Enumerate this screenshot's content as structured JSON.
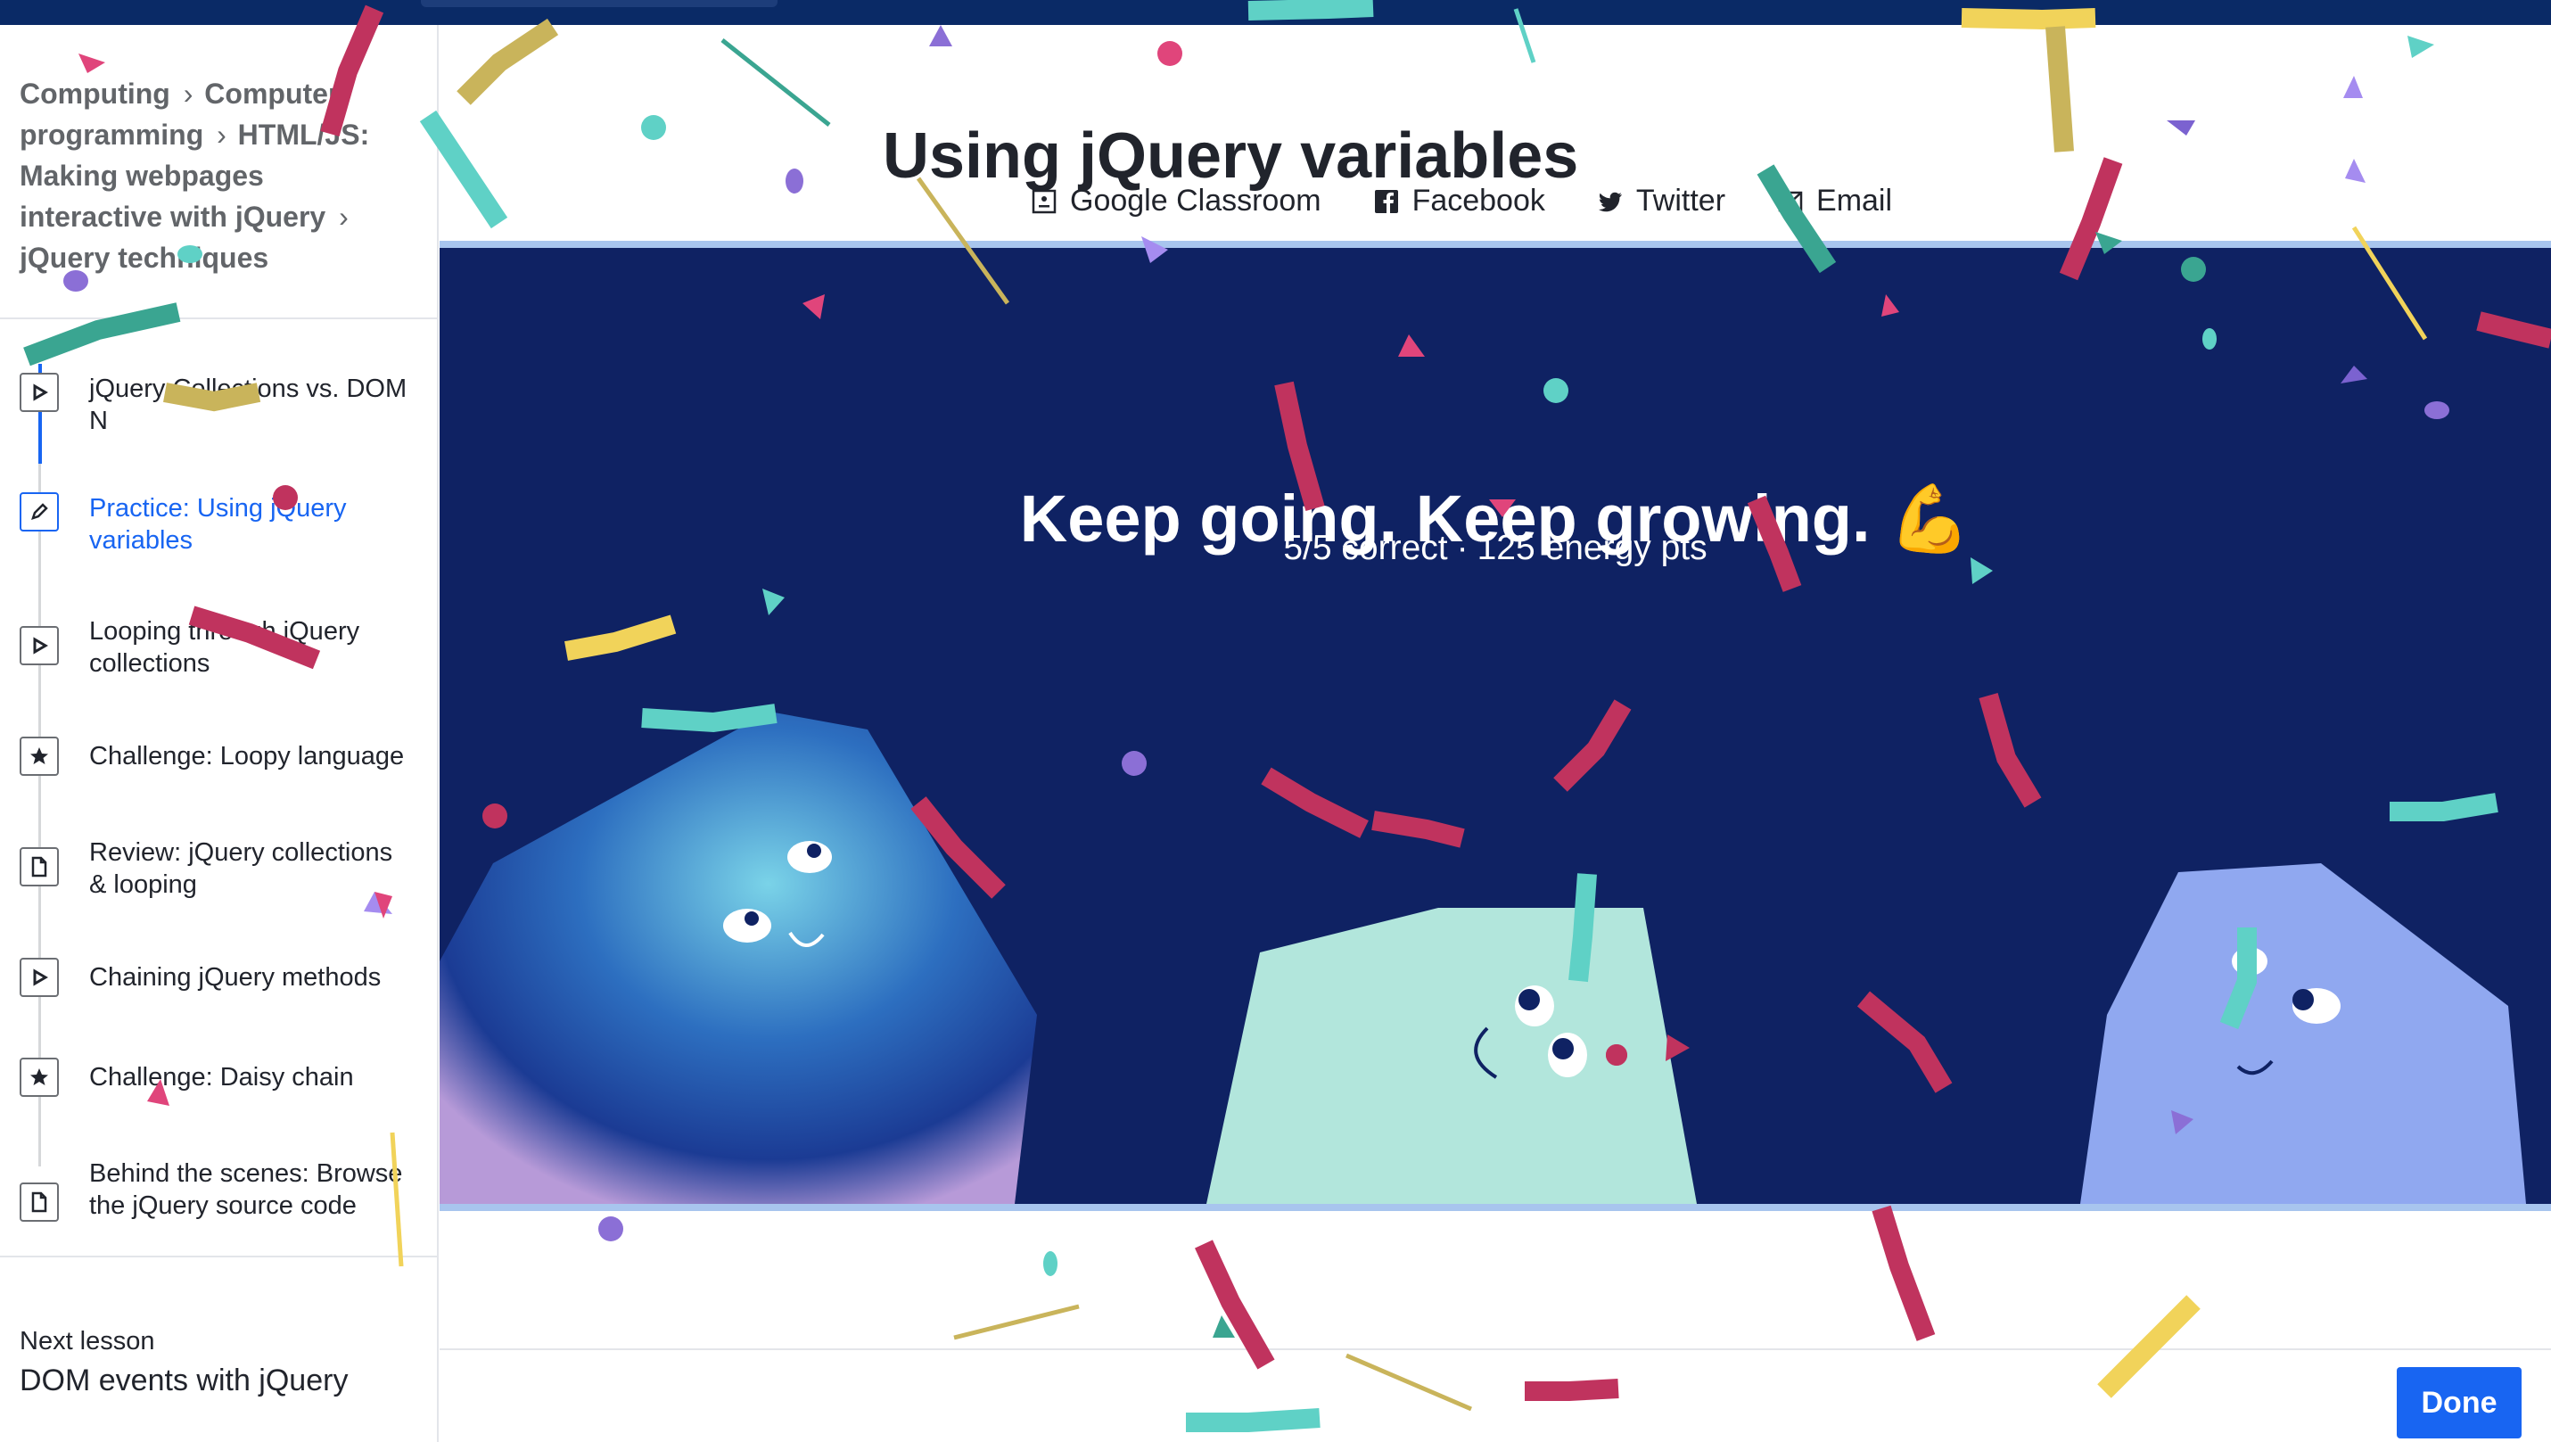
{
  "breadcrumb": [
    "Computing",
    "Computer programming",
    "HTML/JS: Making webpages interactive with jQuery",
    "jQuery techniques"
  ],
  "lessons": [
    {
      "label": "jQuery Collections vs. DOM N",
      "icon": "play-icon",
      "status": "completed"
    },
    {
      "label": "Practice: Using jQuery variables",
      "icon": "pencil-icon",
      "status": "current"
    },
    {
      "label": "Looping through jQuery collections",
      "icon": "play-icon",
      "status": "upcoming"
    },
    {
      "label": "Challenge: Loopy language",
      "icon": "star-icon",
      "status": "upcoming"
    },
    {
      "label": "Review: jQuery collections & looping",
      "icon": "document-icon",
      "status": "upcoming"
    },
    {
      "label": "Chaining jQuery methods",
      "icon": "play-icon",
      "status": "upcoming"
    },
    {
      "label": "Challenge: Daisy chain",
      "icon": "star-icon",
      "status": "upcoming"
    },
    {
      "label": "Behind the scenes: Browse the jQuery source code",
      "icon": "document-icon",
      "status": "upcoming"
    }
  ],
  "next_lesson": {
    "caption": "Next lesson",
    "title": "DOM events with jQuery"
  },
  "page_title": "Using jQuery variables",
  "share": [
    {
      "label": "Google Classroom",
      "icon": "google-classroom-icon"
    },
    {
      "label": "Facebook",
      "icon": "facebook-icon"
    },
    {
      "label": "Twitter",
      "icon": "twitter-icon"
    },
    {
      "label": "Email",
      "icon": "email-icon"
    }
  ],
  "result": {
    "heading": "Keep going. Keep growing. 💪",
    "score": "5/5 correct",
    "separator": "·",
    "energy": "125 energy pts"
  },
  "done_label": "Done",
  "colors": {
    "brand_blue": "#1865f2",
    "hero_bg": "#0f2263",
    "topbar": "#0a2a66",
    "divider": "#a8c5ee"
  }
}
